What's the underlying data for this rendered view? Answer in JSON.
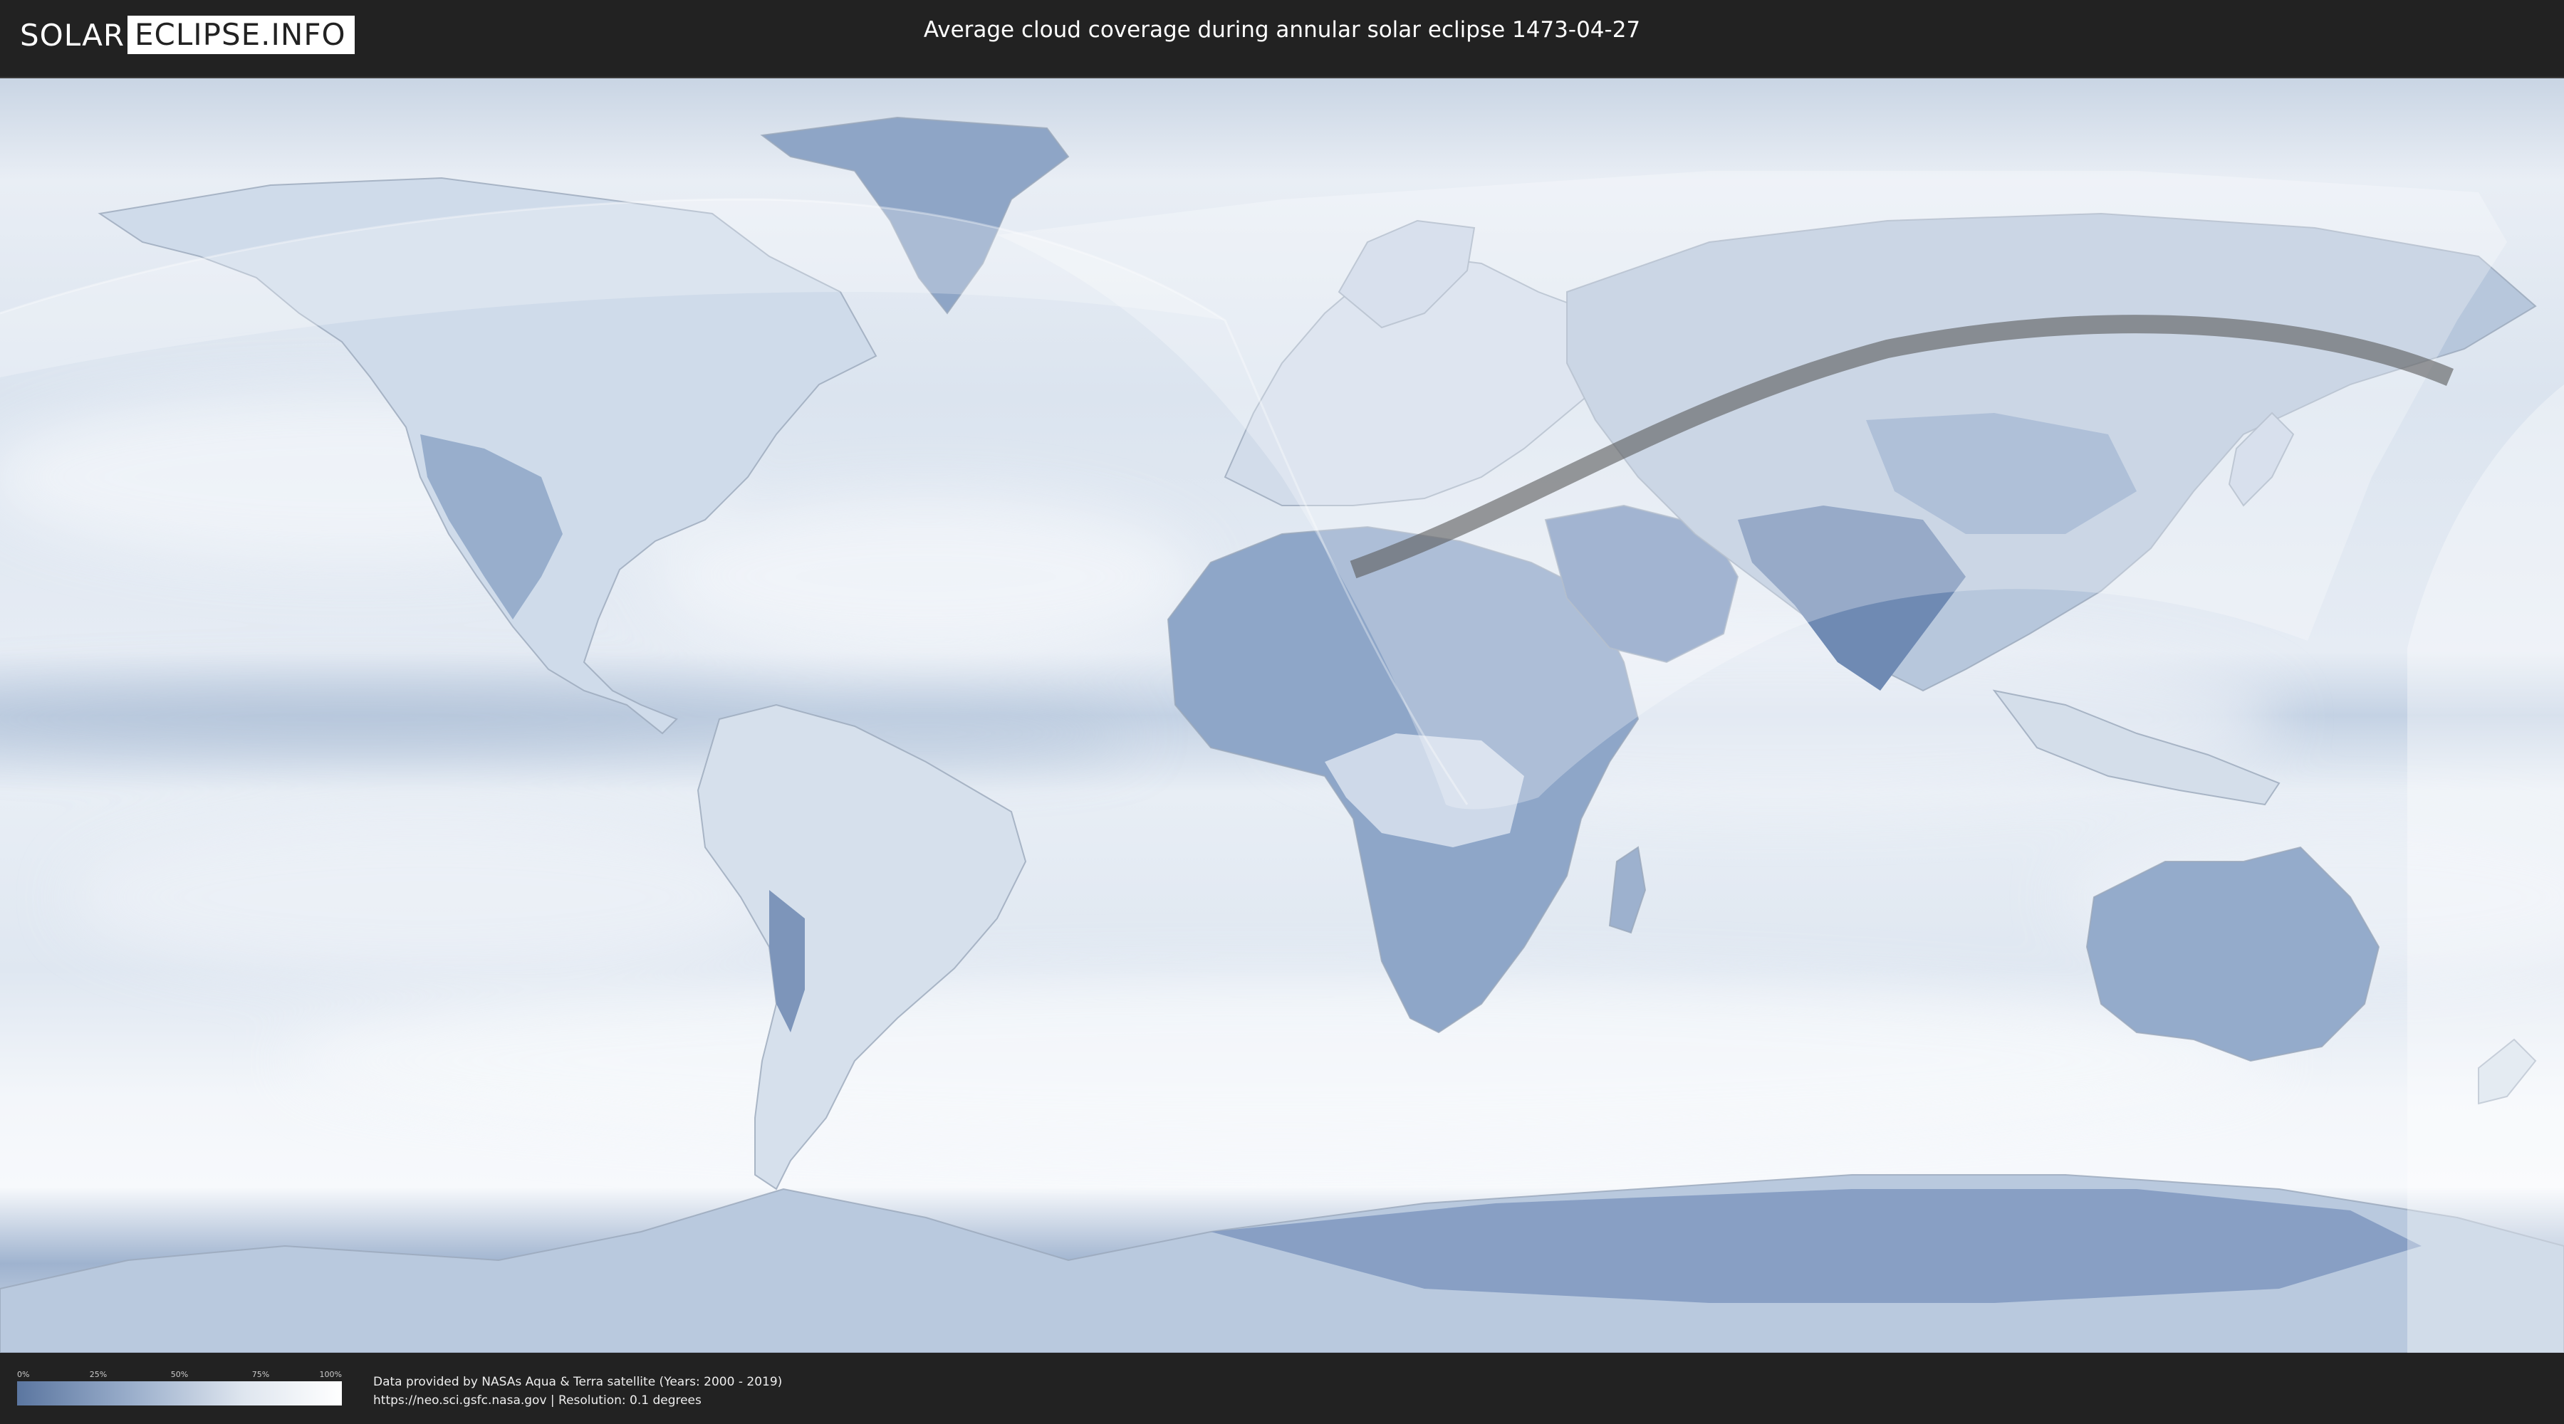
{
  "header": {
    "logo_left": "SOLAR",
    "logo_right": "ECLIPSE.INFO",
    "title": "Average cloud coverage during annular solar eclipse 1473-04-27"
  },
  "map": {
    "ocean_color": "#d7e0ec",
    "cloud_color": "#f4f7fb",
    "clear_sky_color": "#6680aa",
    "penumbra_color": "#ffffff",
    "path_color": "#5a5a5a"
  },
  "legend": {
    "ticks": [
      "0%",
      "25%",
      "50%",
      "75%",
      "100%"
    ],
    "gradient_start": "#5b76a0",
    "gradient_end": "#ffffff"
  },
  "footer": {
    "credit_line1": "Data provided by NASAs Aqua & Terra satellite (Years: 2000 - 2019)",
    "credit_line2": "https://neo.sci.gsfc.nasa.gov | Resolution: 0.1 degrees"
  }
}
